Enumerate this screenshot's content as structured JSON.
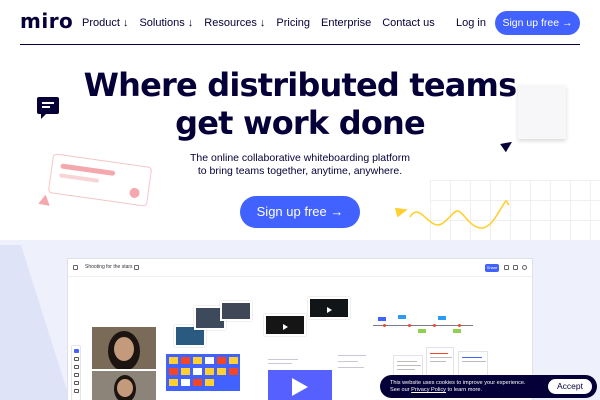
{
  "nav": {
    "logo": "miro",
    "links": [
      "Product ↓",
      "Solutions ↓",
      "Resources ↓",
      "Pricing",
      "Enterprise",
      "Contact us"
    ],
    "login": "Log in",
    "signup": "Sign up free →"
  },
  "hero": {
    "title_line1": "Where distributed teams",
    "title_line2": "get work done",
    "subtitle_line1": "The online collaborative whiteboarding platform",
    "subtitle_line2": "to bring teams together, anytime, anywhere.",
    "cta": "Sign up free →"
  },
  "board": {
    "title": "Shooting for the stars",
    "share": "Share"
  },
  "cookie": {
    "line1": "This website uses cookies to improve your experience.",
    "line2_prefix": "See our ",
    "link": "Privacy Policy",
    "line2_suffix": " to learn more.",
    "accept": "Accept"
  },
  "colors": {
    "brand_blue": "#4262ff",
    "navy": "#050038",
    "yellow": "#ffd02f",
    "pink": "#f4a8ad"
  },
  "icons": [
    "chat-icon",
    "home-icon",
    "upload-icon",
    "cursor-icon",
    "play-icon"
  ]
}
